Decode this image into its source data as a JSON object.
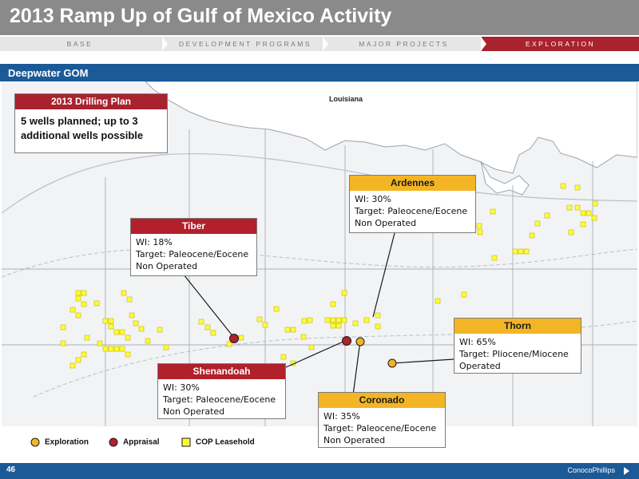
{
  "header": {
    "title": "2013 Ramp Up of Gulf of Mexico Activity"
  },
  "nav": {
    "tabs": [
      {
        "label": "BASE",
        "active": false
      },
      {
        "label": "DEVELOPMENT PROGRAMS",
        "active": false
      },
      {
        "label": "MAJOR PROJECTS",
        "active": false
      },
      {
        "label": "EXPLORATION",
        "active": true
      }
    ]
  },
  "section": {
    "title": "Deepwater GOM"
  },
  "map": {
    "state_label": "Louisiana",
    "colors": {
      "exploration": "#f3b526",
      "appraisal": "#b2202b",
      "leasehold": "#ffff33",
      "water": "#f1f3f4",
      "land": "#ffffff",
      "lines": "#9aa4ad"
    }
  },
  "drilling_plan": {
    "title": "2013 Drilling Plan",
    "text_line1": "5 wells planned; up to 3",
    "text_line2": "additional wells possible"
  },
  "prospects": {
    "tiber": {
      "name": "Tiber",
      "wi": "WI: 18%",
      "target": "Target: Paleocene/Eocene",
      "status": "Non Operated",
      "type": "appraisal"
    },
    "ardennes": {
      "name": "Ardennes",
      "wi": "WI: 30%",
      "target": "Target: Paleocene/Eocene",
      "status": "Non Operated",
      "type": "exploration"
    },
    "thorn": {
      "name": "Thorn",
      "wi": "WI: 65%",
      "target": "Target: Pliocene/Miocene",
      "status": "Operated",
      "type": "exploration"
    },
    "shenandoah": {
      "name": "Shenandoah",
      "wi": "WI: 30%",
      "target": "Target: Paleocene/Eocene",
      "status": "Non Operated",
      "type": "appraisal"
    },
    "coronado": {
      "name": "Coronado",
      "wi": "WI: 35%",
      "target": "Target: Paleocene/Eocene",
      "status": "Non Operated",
      "type": "exploration"
    }
  },
  "legend": {
    "exploration": "Exploration",
    "appraisal": "Appraisal",
    "leasehold": "COP Leasehold"
  },
  "footer": {
    "page_number": "46",
    "logo": "ConocoPhillips"
  }
}
